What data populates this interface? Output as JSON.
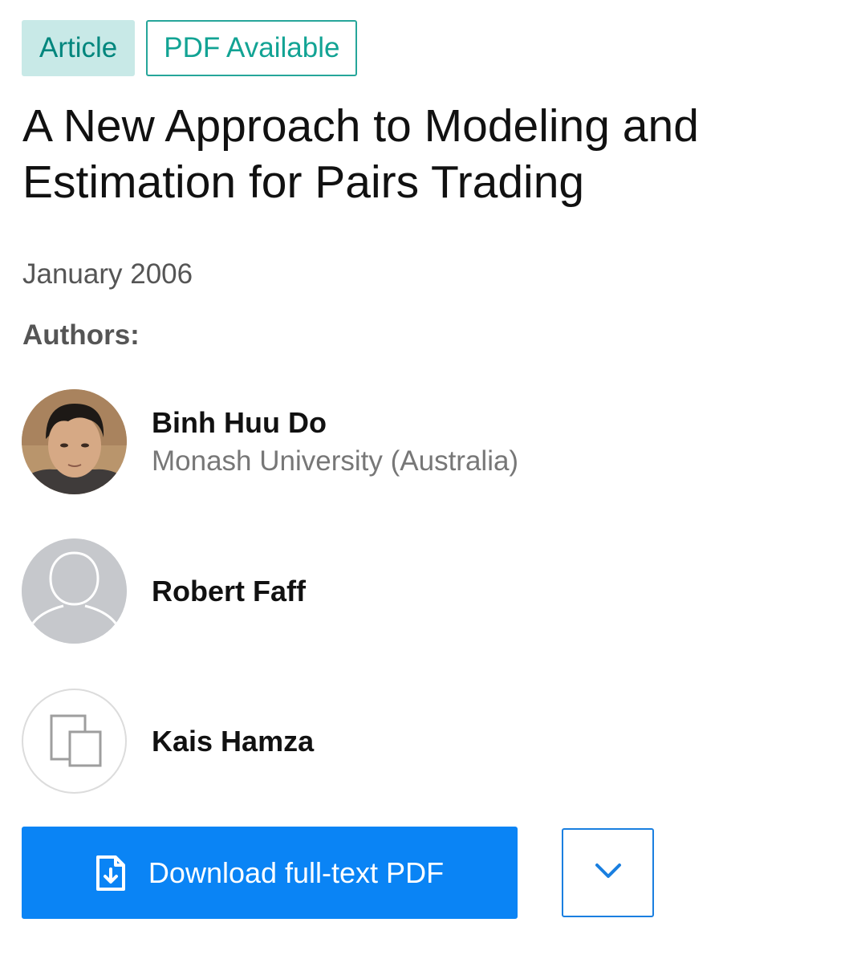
{
  "tags": {
    "article": "Article",
    "pdf_available": "PDF Available"
  },
  "title": "A New Approach to Modeling and Estimation for Pairs Trading",
  "date": "January 2006",
  "authors_label": "Authors:",
  "authors": [
    {
      "name": "Binh Huu Do",
      "affiliation": "Monash University (Australia)",
      "avatar": "photo"
    },
    {
      "name": "Robert Faff",
      "affiliation": "",
      "avatar": "person-silhouette-icon"
    },
    {
      "name": "Kais Hamza",
      "affiliation": "",
      "avatar": "overlapping-squares-icon"
    }
  ],
  "actions": {
    "download_label": "Download full-text PDF",
    "download_icon": "file-download-icon",
    "more_icon": "chevron-down-icon"
  },
  "colors": {
    "primary": "#0a84f5",
    "tag_teal": "#12a394",
    "tag_bg": "#c8e9e7"
  }
}
